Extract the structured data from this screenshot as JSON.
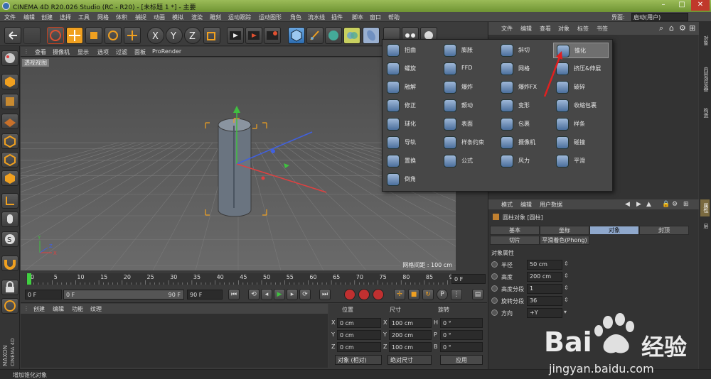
{
  "app": {
    "title": "CINEMA 4D R20.026 Studio (RC - R20) - [未标题 1 *] - 主要",
    "layout_label": "界面:",
    "layout_value": "启动(用户)"
  },
  "menu": [
    "文件",
    "编辑",
    "创建",
    "选择",
    "工具",
    "网格",
    "体积",
    "捕捉",
    "动画",
    "模拟",
    "渲染",
    "雕刻",
    "运动跟踪",
    "运动图形",
    "角色",
    "流水线",
    "插件",
    "脚本",
    "窗口",
    "帮助"
  ],
  "viewport": {
    "menu": [
      "查看",
      "摄像机",
      "显示",
      "选项",
      "过滤",
      "面板",
      "ProRender"
    ],
    "label": "透视视图",
    "grid_info": "网格间距 : 100 cm"
  },
  "timeline": {
    "ticks": [
      "0",
      "5",
      "10",
      "15",
      "20",
      "25",
      "30",
      "35",
      "40",
      "45",
      "50",
      "55",
      "60",
      "65",
      "70",
      "75",
      "80",
      "85",
      "90"
    ],
    "current_frame": "0 F",
    "start_field": "0 F",
    "range_start": "0 F",
    "range_end": "90 F",
    "end_field": "90 F"
  },
  "material_panel": {
    "menu": [
      "创建",
      "编辑",
      "功能",
      "纹理"
    ]
  },
  "coords": {
    "headers": [
      "位置",
      "尺寸",
      "旋转"
    ],
    "rows": [
      {
        "axis": "X",
        "pos": "0 cm",
        "size_axis": "X",
        "size": "100 cm",
        "rot_axis": "H",
        "rot": "0 °"
      },
      {
        "axis": "Y",
        "pos": "0 cm",
        "size_axis": "Y",
        "size": "200 cm",
        "rot_axis": "P",
        "rot": "0 °"
      },
      {
        "axis": "Z",
        "pos": "0 cm",
        "size_axis": "Z",
        "size": "100 cm",
        "rot_axis": "B",
        "rot": "0 °"
      }
    ],
    "mode_select": "对象 (相对)",
    "size_select": "绝对尺寸",
    "apply_button": "应用"
  },
  "objects_panel": {
    "menu": [
      "文件",
      "编辑",
      "查看",
      "对象",
      "标签",
      "书签"
    ]
  },
  "attributes": {
    "menu": [
      "模式",
      "编辑",
      "用户数据"
    ],
    "object_title": "圆柱对象 [圆柱]",
    "tabs": [
      "基本",
      "坐标",
      "对象",
      "封顶"
    ],
    "tabs2": [
      "切片",
      "平滑着色(Phong)"
    ],
    "active_tab": "对象",
    "section": "对象属性",
    "props": [
      {
        "label": "半径",
        "value": "50 cm"
      },
      {
        "label": "高度",
        "value": "200 cm"
      },
      {
        "label": "高度分段",
        "value": "1"
      },
      {
        "label": "旋转分段",
        "value": "36"
      },
      {
        "label": "方向",
        "value": "+Y"
      }
    ]
  },
  "right_tabs": [
    "对象",
    "内容浏览器",
    "构造"
  ],
  "right_tabs2": [
    "属性",
    "层"
  ],
  "deformers": [
    {
      "label": "扭曲",
      "icon": "bend-icon"
    },
    {
      "label": "膨胀",
      "icon": "bulge-icon"
    },
    {
      "label": "斜切",
      "icon": "shear-icon"
    },
    {
      "label": "锥化",
      "icon": "taper-icon"
    },
    {
      "label": "螺旋",
      "icon": "twist-icon"
    },
    {
      "label": "FFD",
      "icon": "ffd-icon"
    },
    {
      "label": "网格",
      "icon": "mesh-icon"
    },
    {
      "label": "挤压&伸展",
      "icon": "squash-icon"
    },
    {
      "label": "融解",
      "icon": "melt-icon"
    },
    {
      "label": "爆炸",
      "icon": "explosion-icon"
    },
    {
      "label": "爆炸FX",
      "icon": "explosion-fx-icon"
    },
    {
      "label": "破碎",
      "icon": "shatter-icon"
    },
    {
      "label": "修正",
      "icon": "correction-icon"
    },
    {
      "label": "颤动",
      "icon": "jiggle-icon"
    },
    {
      "label": "变形",
      "icon": "morph-icon"
    },
    {
      "label": "收缩包裹",
      "icon": "shrink-wrap-icon"
    },
    {
      "label": "球化",
      "icon": "spherify-icon"
    },
    {
      "label": "表面",
      "icon": "surface-icon"
    },
    {
      "label": "包裹",
      "icon": "wrap-icon"
    },
    {
      "label": "样条",
      "icon": "spline-icon"
    },
    {
      "label": "导轨",
      "icon": "rail-icon"
    },
    {
      "label": "样条约束",
      "icon": "spline-wrap-icon"
    },
    {
      "label": "摄像机",
      "icon": "camera-icon"
    },
    {
      "label": "碰撞",
      "icon": "collision-icon"
    },
    {
      "label": "置换",
      "icon": "displacer-icon"
    },
    {
      "label": "公式",
      "icon": "formula-icon"
    },
    {
      "label": "风力",
      "icon": "wind-icon"
    },
    {
      "label": "平滑",
      "icon": "smoothing-icon"
    },
    {
      "label": "倒角",
      "icon": "bevel-icon"
    }
  ],
  "highlighted_deformer": "锥化",
  "status": "增加锥化对象",
  "watermark": {
    "brand": "Bai",
    "brand2": "经验",
    "url": "jingyan.baidu.com"
  },
  "colors": {
    "accent": "#8fa8cc",
    "x_axis": "#e04040",
    "y_axis": "#40c040",
    "z_axis": "#4060e0",
    "selection": "#f0a020"
  }
}
